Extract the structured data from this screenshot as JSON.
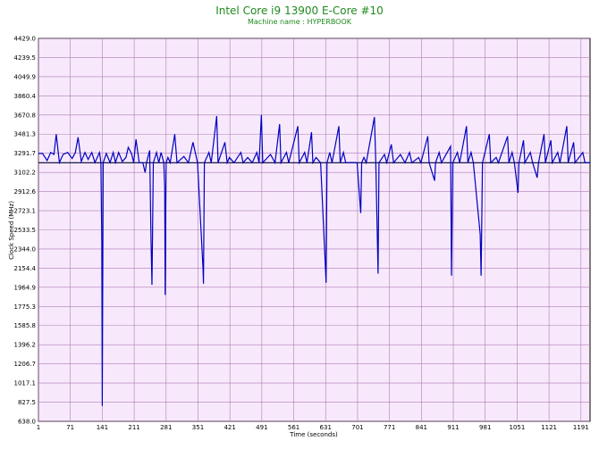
{
  "chart_data": {
    "type": "line",
    "title": "Intel Core i9 13900 E-Core #10",
    "subtitle": "Machine name : HYPERBOOK",
    "xlabel": "Time (seconds)",
    "ylabel": "Clock Speed (MHz)",
    "xlim": [
      1,
      1211
    ],
    "ylim": [
      638.0,
      4429.0
    ],
    "x_ticks": [
      "1",
      "71",
      "141",
      "211",
      "281",
      "351",
      "421",
      "491",
      "561",
      "631",
      "701",
      "771",
      "841",
      "911",
      "981",
      "1051",
      "1121",
      "1191"
    ],
    "y_ticks": [
      "4429.0",
      "4239.5",
      "4049.9",
      "3860.4",
      "3670.8",
      "3481.3",
      "3291.7",
      "3102.2",
      "2912.6",
      "2723.1",
      "2533.5",
      "2344.0",
      "2154.4",
      "1964.9",
      "1775.3",
      "1585.8",
      "1396.2",
      "1206.7",
      "1017.1",
      "827.5",
      "638.0"
    ],
    "grid": true,
    "colors": {
      "line": "#0000c0",
      "plot_bg": "#f7e9fb",
      "grid": "#b07ab8",
      "title": "#1f8a1f"
    },
    "baseline": 3198,
    "series": [
      {
        "values": [
          [
            1,
            3290
          ],
          [
            10,
            3290
          ],
          [
            20,
            3220
          ],
          [
            28,
            3300
          ],
          [
            35,
            3280
          ],
          [
            40,
            3480
          ],
          [
            47,
            3200
          ],
          [
            55,
            3280
          ],
          [
            65,
            3300
          ],
          [
            75,
            3240
          ],
          [
            82,
            3300
          ],
          [
            88,
            3450
          ],
          [
            95,
            3210
          ],
          [
            103,
            3300
          ],
          [
            110,
            3230
          ],
          [
            118,
            3300
          ],
          [
            125,
            3200
          ],
          [
            135,
            3300
          ],
          [
            138,
            3200
          ],
          [
            140,
            2410
          ],
          [
            141,
            790
          ],
          [
            143,
            3198
          ],
          [
            150,
            3290
          ],
          [
            158,
            3200
          ],
          [
            165,
            3300
          ],
          [
            170,
            3200
          ],
          [
            177,
            3300
          ],
          [
            185,
            3210
          ],
          [
            193,
            3250
          ],
          [
            198,
            3350
          ],
          [
            205,
            3290
          ],
          [
            210,
            3200
          ],
          [
            215,
            3430
          ],
          [
            222,
            3198
          ],
          [
            230,
            3198
          ],
          [
            235,
            3100
          ],
          [
            238,
            3198
          ],
          [
            245,
            3320
          ],
          [
            248,
            2420
          ],
          [
            250,
            1990
          ],
          [
            253,
            3198
          ],
          [
            260,
            3300
          ],
          [
            265,
            3198
          ],
          [
            270,
            3300
          ],
          [
            276,
            3198
          ],
          [
            278,
            2940
          ],
          [
            279,
            1890
          ],
          [
            281,
            3198
          ],
          [
            285,
            3250
          ],
          [
            290,
            3198
          ],
          [
            300,
            3480
          ],
          [
            305,
            3198
          ],
          [
            320,
            3260
          ],
          [
            330,
            3198
          ],
          [
            340,
            3400
          ],
          [
            350,
            3198
          ],
          [
            362,
            2150
          ],
          [
            363,
            2000
          ],
          [
            365,
            3198
          ],
          [
            375,
            3300
          ],
          [
            380,
            3198
          ],
          [
            392,
            3660
          ],
          [
            395,
            3198
          ],
          [
            410,
            3400
          ],
          [
            415,
            3198
          ],
          [
            420,
            3250
          ],
          [
            430,
            3198
          ],
          [
            445,
            3300
          ],
          [
            450,
            3198
          ],
          [
            460,
            3250
          ],
          [
            470,
            3198
          ],
          [
            480,
            3300
          ],
          [
            485,
            3198
          ],
          [
            490,
            3670
          ],
          [
            493,
            3198
          ],
          [
            510,
            3280
          ],
          [
            520,
            3198
          ],
          [
            530,
            3580
          ],
          [
            533,
            3198
          ],
          [
            545,
            3300
          ],
          [
            550,
            3198
          ],
          [
            570,
            3560
          ],
          [
            573,
            3198
          ],
          [
            585,
            3300
          ],
          [
            590,
            3198
          ],
          [
            600,
            3500
          ],
          [
            603,
            3198
          ],
          [
            610,
            3250
          ],
          [
            620,
            3198
          ],
          [
            632,
            2010
          ],
          [
            634,
            3198
          ],
          [
            640,
            3300
          ],
          [
            645,
            3198
          ],
          [
            660,
            3560
          ],
          [
            663,
            3198
          ],
          [
            670,
            3300
          ],
          [
            675,
            3198
          ],
          [
            690,
            3200
          ],
          [
            700,
            3198
          ],
          [
            708,
            2700
          ],
          [
            710,
            3198
          ],
          [
            715,
            3250
          ],
          [
            720,
            3198
          ],
          [
            738,
            3650
          ],
          [
            741,
            3198
          ],
          [
            746,
            2100
          ],
          [
            748,
            3198
          ],
          [
            760,
            3280
          ],
          [
            765,
            3198
          ],
          [
            775,
            3380
          ],
          [
            780,
            3198
          ],
          [
            795,
            3280
          ],
          [
            805,
            3198
          ],
          [
            815,
            3300
          ],
          [
            820,
            3198
          ],
          [
            835,
            3250
          ],
          [
            840,
            3198
          ],
          [
            855,
            3460
          ],
          [
            858,
            3198
          ],
          [
            870,
            3020
          ],
          [
            872,
            3198
          ],
          [
            880,
            3300
          ],
          [
            885,
            3198
          ],
          [
            905,
            3360
          ],
          [
            907,
            2080
          ],
          [
            910,
            3198
          ],
          [
            920,
            3300
          ],
          [
            925,
            3198
          ],
          [
            940,
            3560
          ],
          [
            943,
            3198
          ],
          [
            950,
            3300
          ],
          [
            955,
            3198
          ],
          [
            970,
            2490
          ],
          [
            972,
            2080
          ],
          [
            975,
            3198
          ],
          [
            990,
            3480
          ],
          [
            993,
            3198
          ],
          [
            1005,
            3250
          ],
          [
            1010,
            3198
          ],
          [
            1030,
            3460
          ],
          [
            1033,
            3198
          ],
          [
            1040,
            3300
          ],
          [
            1045,
            3198
          ],
          [
            1053,
            2900
          ],
          [
            1055,
            3198
          ],
          [
            1065,
            3420
          ],
          [
            1068,
            3198
          ],
          [
            1080,
            3300
          ],
          [
            1085,
            3198
          ],
          [
            1095,
            3050
          ],
          [
            1098,
            3198
          ],
          [
            1110,
            3480
          ],
          [
            1113,
            3198
          ],
          [
            1125,
            3420
          ],
          [
            1128,
            3198
          ],
          [
            1140,
            3300
          ],
          [
            1145,
            3198
          ],
          [
            1160,
            3560
          ],
          [
            1163,
            3198
          ],
          [
            1175,
            3400
          ],
          [
            1178,
            3198
          ],
          [
            1195,
            3300
          ],
          [
            1200,
            3198
          ],
          [
            1211,
            3198
          ]
        ]
      }
    ]
  }
}
